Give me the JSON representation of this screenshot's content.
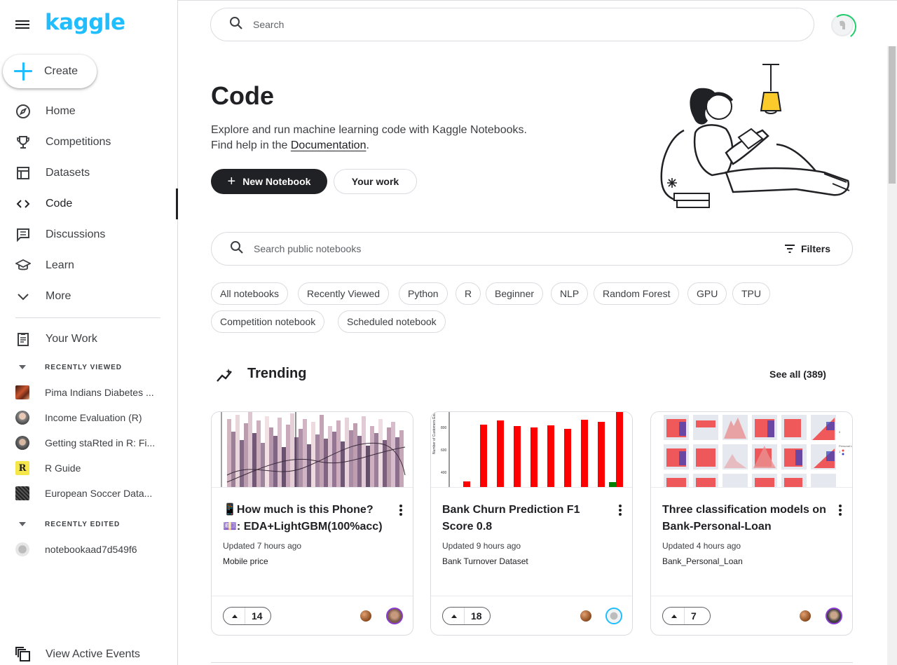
{
  "brand": {
    "logo": "kaggle",
    "accent": "#20beff"
  },
  "sidebar": {
    "create_label": "Create",
    "items": [
      {
        "label": "Home",
        "icon": "compass-icon"
      },
      {
        "label": "Competitions",
        "icon": "trophy-icon"
      },
      {
        "label": "Datasets",
        "icon": "table-icon"
      },
      {
        "label": "Code",
        "icon": "code-icon",
        "active": true
      },
      {
        "label": "Discussions",
        "icon": "chat-icon"
      },
      {
        "label": "Learn",
        "icon": "school-icon"
      },
      {
        "label": "More",
        "icon": "chevron-down-icon"
      }
    ],
    "your_work": "Your Work",
    "recently_viewed_label": "RECENTLY VIEWED",
    "recently_viewed": [
      "Pima Indians Diabetes ...",
      "Income Evaluation (R)",
      "Getting staRted in R: Fi...",
      "R Guide",
      "European Soccer Data..."
    ],
    "recently_edited_label": "RECENTLY EDITED",
    "recently_edited": [
      "notebookaad7d549f6"
    ],
    "view_active_events": "View Active Events"
  },
  "header": {
    "search_placeholder": "Search"
  },
  "hero": {
    "title": "Code",
    "desc_line1": "Explore and run machine learning code with Kaggle Notebooks.",
    "desc_line2_prefix": "Find help in the ",
    "desc_link": "Documentation",
    "desc_line2_suffix": ".",
    "new_notebook": "New Notebook",
    "your_work": "Your work"
  },
  "notebook_search": {
    "placeholder": "Search public notebooks",
    "filters_label": "Filters"
  },
  "chips": [
    "All notebooks",
    "Recently Viewed",
    "Python",
    "R",
    "Beginner",
    "NLP",
    "Random Forest",
    "GPU",
    "TPU",
    "Competition notebook",
    "Scheduled notebook"
  ],
  "trending": {
    "title": "Trending",
    "see_all": "See all (389)",
    "cards": [
      {
        "title": "📱How much is this Phone?💷: EDA+LightGBM(100%acc)",
        "updated": "Updated 7 hours ago",
        "source": "Mobile price",
        "votes": "14"
      },
      {
        "title": "Bank Churn Prediction F1 Score 0.8",
        "updated": "Updated 9 hours ago",
        "source": "Bank Turnover Dataset",
        "votes": "18"
      },
      {
        "title": "Three classification models on Bank-Personal-Loan",
        "updated": "Updated 4 hours ago",
        "source": "Bank_Personal_Loan",
        "votes": "7"
      }
    ]
  }
}
